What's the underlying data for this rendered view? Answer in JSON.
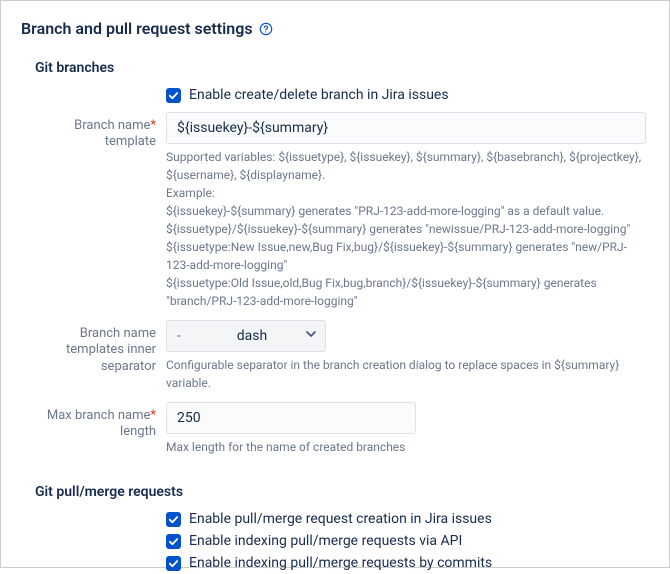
{
  "page_title": "Branch and pull request settings",
  "sections": {
    "git_branches": {
      "title": "Git branches",
      "enable_create_delete": {
        "label": "Enable create/delete branch in Jira issues",
        "checked": true
      },
      "branch_name_template": {
        "label_line1": "Branch name",
        "label_line2": "template",
        "required": true,
        "value": "${issuekey}-${summary}",
        "help": [
          "Supported variables: ${issuetype}, ${issuekey}, ${summary}, ${basebranch}, ${projectkey}, ${username}, ${displayname}.",
          "Example:",
          "${issuekey}-${summary} generates \"PRJ-123-add-more-logging\" as a default value.",
          "${issuetype}/${issuekey}-${summary} generates \"newissue/PRJ-123-add-more-logging\"",
          "${issuetype:New Issue,new,Bug Fix,bug}/${issuekey}-${summary} generates \"new/PRJ-123-add-more-logging\"",
          "${issuetype:Old Issue,old,Bug Fix,bug,branch}/${issuekey}-${summary} generates \"branch/PRJ-123-add-more-logging\""
        ]
      },
      "inner_separator": {
        "label_line1": "Branch name",
        "label_line2": "templates inner",
        "label_line3": "separator",
        "symbol": "-",
        "name": "dash",
        "help": "Configurable separator in the branch creation dialog to replace spaces in ${summary} variable."
      },
      "max_length": {
        "label_line1": "Max branch name",
        "label_line2": "length",
        "required": true,
        "value": "250",
        "help": "Max length for the name of created branches"
      }
    },
    "git_pull_merge": {
      "title": "Git pull/merge requests",
      "enable_creation": {
        "label": "Enable pull/merge request creation in Jira issues",
        "checked": true
      },
      "enable_index_api": {
        "label": "Enable indexing pull/merge requests via API",
        "checked": true
      },
      "enable_index_commits": {
        "label": "Enable indexing pull/merge requests by commits",
        "checked": true
      }
    }
  }
}
